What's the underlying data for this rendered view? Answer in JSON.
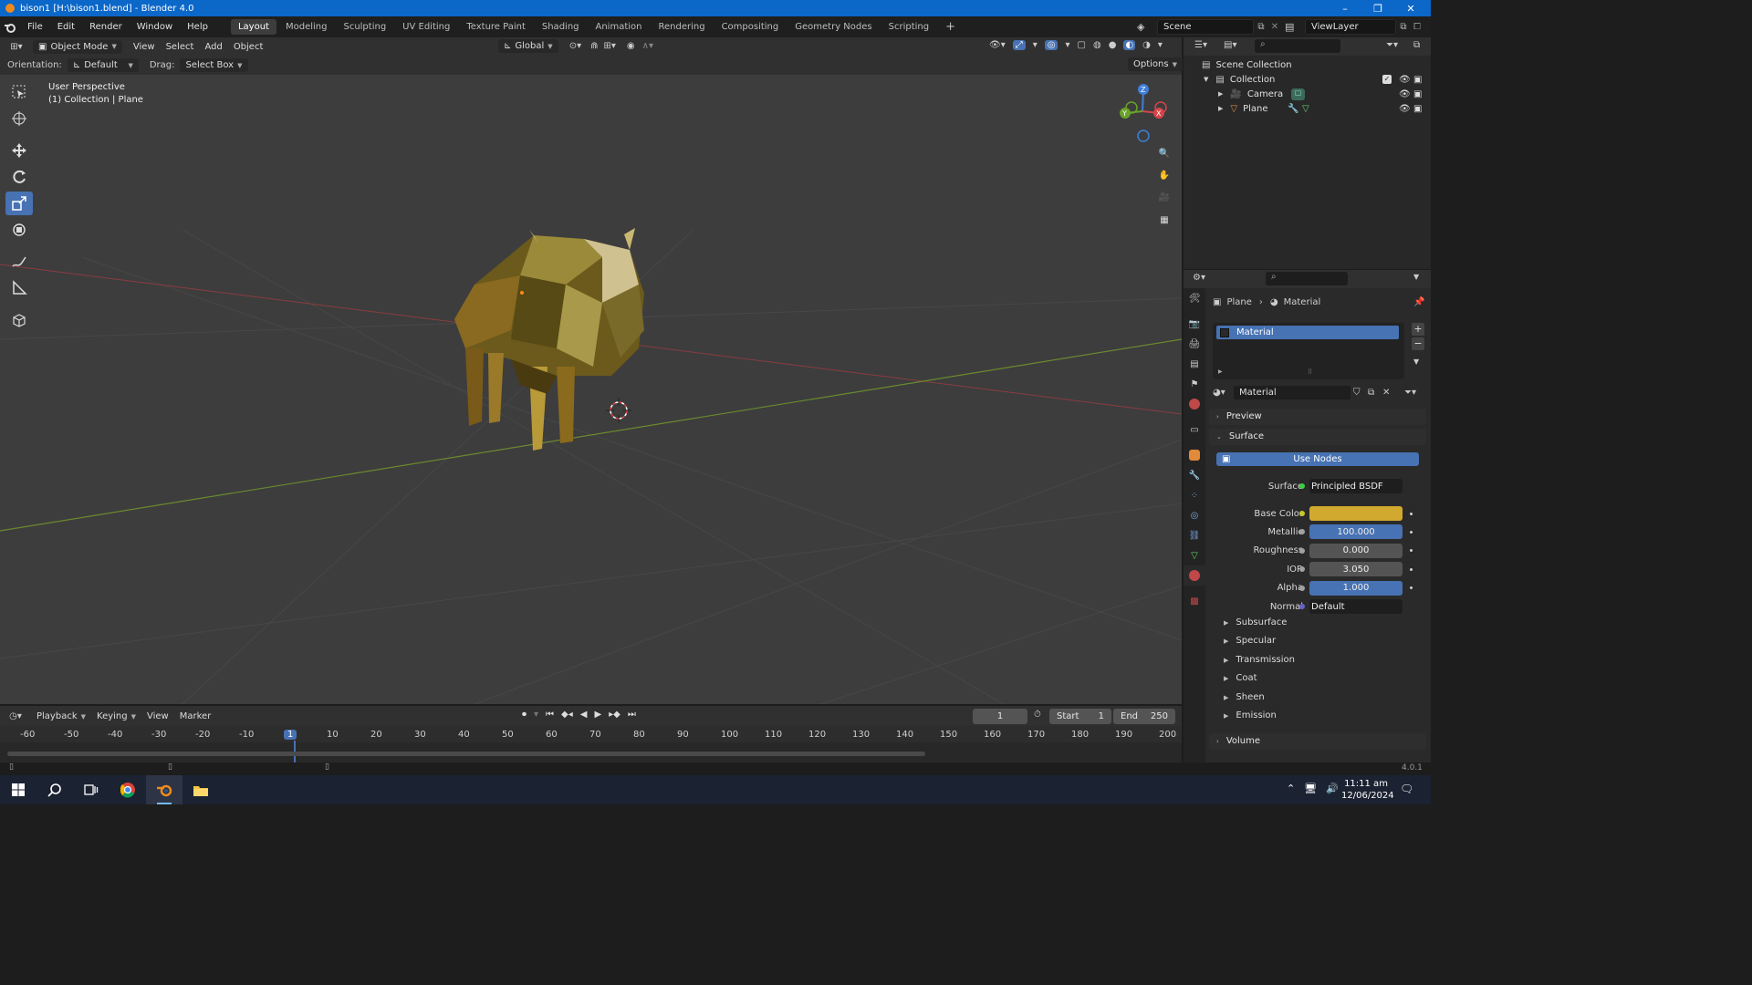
{
  "window": {
    "title": "bison1 [H:\\bison1.blend] - Blender 4.0",
    "minimize": "–",
    "maximize": "❐",
    "close": "✕"
  },
  "menu": {
    "items": [
      "File",
      "Edit",
      "Render",
      "Window",
      "Help"
    ]
  },
  "workspaces": {
    "tabs": [
      "Layout",
      "Modeling",
      "Sculpting",
      "UV Editing",
      "Texture Paint",
      "Shading",
      "Animation",
      "Rendering",
      "Compositing",
      "Geometry Nodes",
      "Scripting"
    ],
    "active": "Layout",
    "add": "+"
  },
  "scene": {
    "name": "Scene",
    "view_layer": "ViewLayer"
  },
  "viewport_header": {
    "mode": "Object Mode",
    "menus": [
      "View",
      "Select",
      "Add",
      "Object"
    ],
    "transform_orientation": "Global",
    "orientation_label": "Orientation:",
    "orientation_value": "Default",
    "drag_label": "Drag:",
    "drag_value": "Select Box",
    "options": "Options"
  },
  "viewport": {
    "perspective": "User Perspective",
    "collection_info": "(1) Collection | Plane",
    "gizmo": {
      "z": "Z",
      "y": "Y",
      "x": "X"
    }
  },
  "timeline": {
    "menus": [
      "Playback",
      "Keying",
      "View",
      "Marker"
    ],
    "current_frame": "1",
    "start_label": "Start",
    "start": "1",
    "end_label": "End",
    "end": "250",
    "ticks": [
      "-60",
      "-50",
      "-40",
      "-30",
      "-20",
      "-10",
      "1",
      "10",
      "20",
      "30",
      "40",
      "50",
      "60",
      "70",
      "80",
      "90",
      "100",
      "110",
      "120",
      "130",
      "140",
      "150",
      "160",
      "170",
      "180",
      "190",
      "200"
    ]
  },
  "outliner": {
    "root": "Scene Collection",
    "collection": "Collection",
    "items": [
      {
        "name": "Camera",
        "icon": "camera-icon"
      },
      {
        "name": "Plane",
        "icon": "mesh-icon"
      }
    ]
  },
  "properties": {
    "breadcrumb_object": "Plane",
    "breadcrumb_material": "Material",
    "slot_name": "Material",
    "material_name": "Material",
    "panels": {
      "preview": "Preview",
      "surface": "Surface",
      "use_nodes": "Use Nodes",
      "volume": "Volume"
    },
    "surface_label": "Surface",
    "surface_value": "Principled BSDF",
    "inputs": [
      {
        "label": "Base Color",
        "value": "",
        "kind": "color"
      },
      {
        "label": "Metallic",
        "value": "100.000",
        "kind": "slider",
        "fill": 1.0
      },
      {
        "label": "Roughness",
        "value": "0.000",
        "kind": "slider",
        "fill": 0.0
      },
      {
        "label": "IOR",
        "value": "3.050",
        "kind": "field"
      },
      {
        "label": "Alpha",
        "value": "1.000",
        "kind": "slider",
        "fill": 1.0
      },
      {
        "label": "Normal",
        "value": "Default",
        "kind": "link"
      }
    ],
    "subpanels": [
      "Subsurface",
      "Specular",
      "Transmission",
      "Coat",
      "Sheen",
      "Emission"
    ],
    "version": "4.0.1"
  },
  "taskbar": {
    "time": "11:11 am",
    "date": "12/06/2024"
  },
  "colors": {
    "accent": "#4772b3",
    "base_color": "#d2a92f",
    "viewport_bg": "#3d3d3d"
  }
}
